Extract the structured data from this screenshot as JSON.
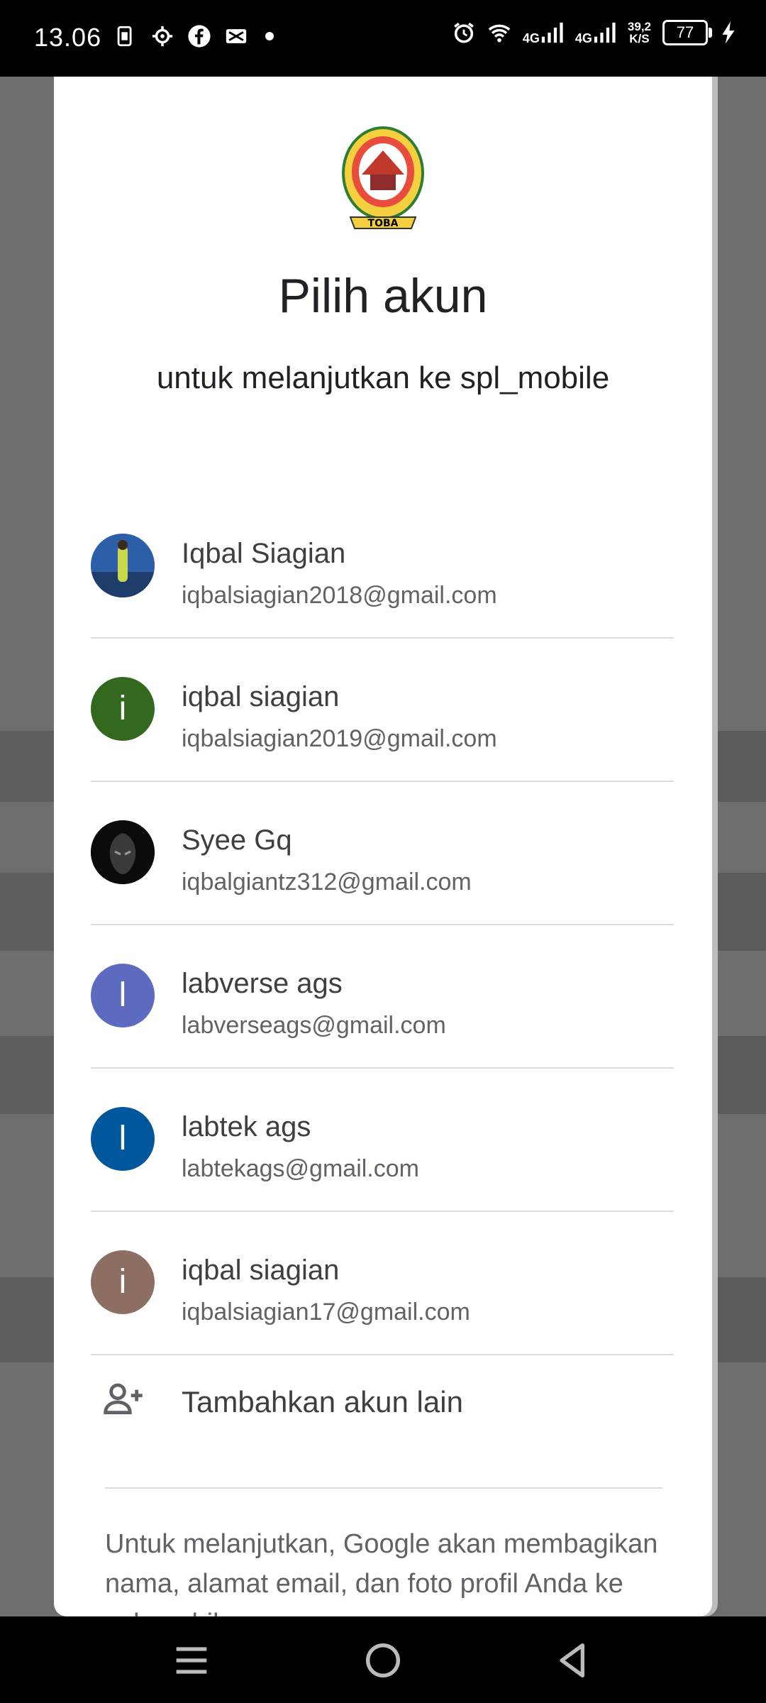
{
  "status_bar": {
    "time": "13.06",
    "network_1": "4G",
    "network_2": "4G",
    "speed_value": "39,2",
    "speed_unit": "K/S",
    "battery": "77",
    "left_icons": [
      "sim-icon",
      "settings-icon",
      "facebook-icon",
      "capcut-icon",
      "dot-icon"
    ],
    "right_icons": [
      "alarm-icon",
      "wifi-icon",
      "signal-icon",
      "signal-icon",
      "battery-icon",
      "charging-icon"
    ]
  },
  "dialog": {
    "logo": "toba-logo",
    "title": "Pilih akun",
    "subtitle": "untuk melanjutkan ke spl_mobile",
    "accounts": [
      {
        "name": "Iqbal Siagian",
        "email": "iqbalsiagian2018@gmail.com",
        "avatar": "photo-person",
        "initial": "",
        "color": "#3b6fb5"
      },
      {
        "name": "iqbal siagian",
        "email": "iqbalsiagian2019@gmail.com",
        "avatar": "initial",
        "initial": "i",
        "color": "#33691e"
      },
      {
        "name": "Syee Gq",
        "email": "iqbalgiantz312@gmail.com",
        "avatar": "photo-dark",
        "initial": "",
        "color": "#111111"
      },
      {
        "name": "labverse ags",
        "email": "labverseags@gmail.com",
        "avatar": "initial",
        "initial": "l",
        "color": "#5c6bc0"
      },
      {
        "name": "labtek ags",
        "email": "labtekags@gmail.com",
        "avatar": "initial",
        "initial": "l",
        "color": "#01579b"
      },
      {
        "name": "iqbal siagian",
        "email": "iqbalsiagian17@gmail.com",
        "avatar": "initial",
        "initial": "i",
        "color": "#8d6e63"
      }
    ],
    "add_account_label": "Tambahkan akun lain",
    "consent_text": "Untuk melanjutkan, Google akan membagikan nama, alamat email, dan foto profil Anda ke spl_mobile."
  },
  "nav_bar": {
    "buttons": [
      "menu-icon",
      "home-icon",
      "back-icon"
    ]
  }
}
